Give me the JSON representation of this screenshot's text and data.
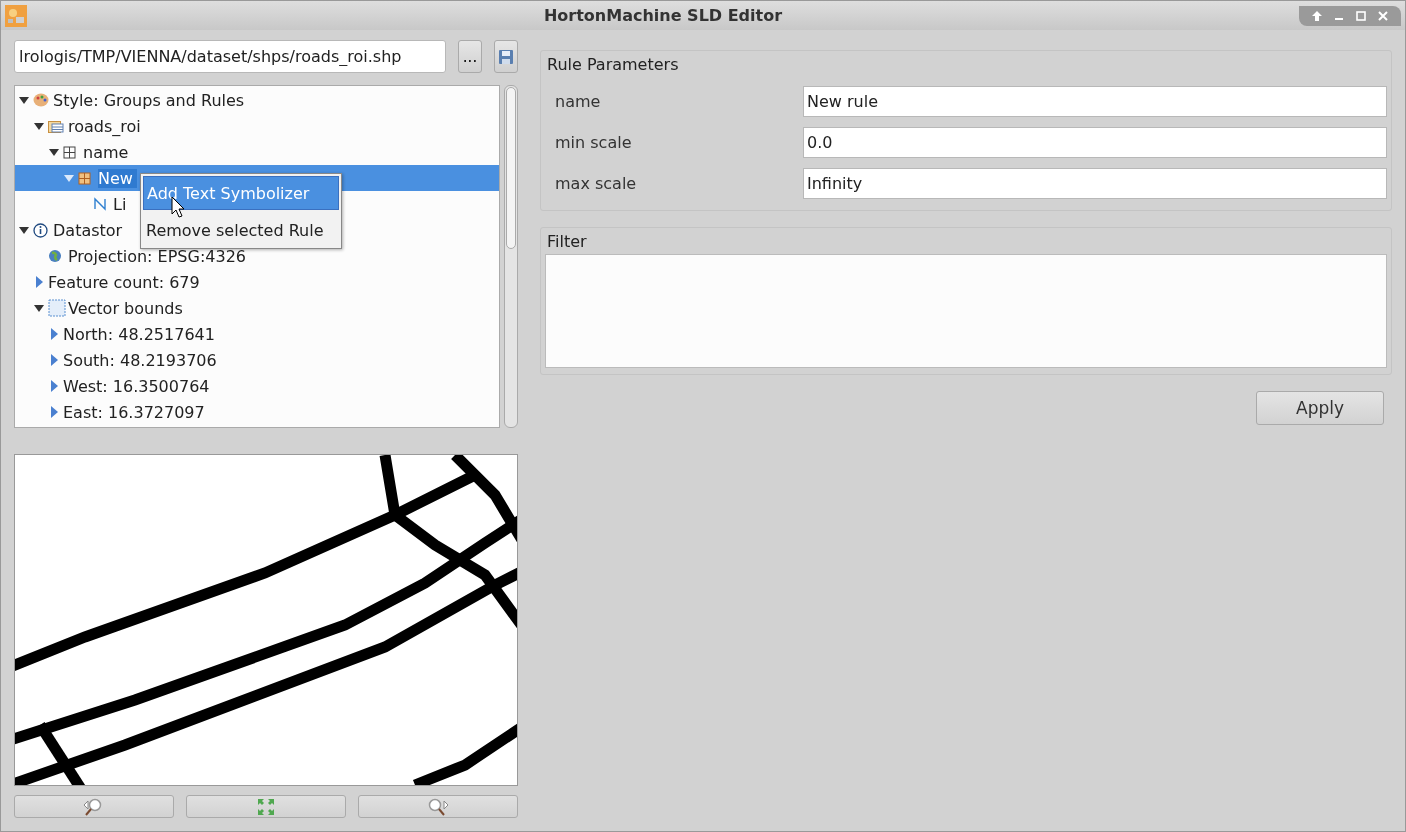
{
  "window": {
    "title": "HortonMachine SLD Editor"
  },
  "path_field": {
    "value": "lrologis/TMP/VIENNA/dataset/shps/roads_roi.shp"
  },
  "browse_button": {
    "label": "..."
  },
  "tree": [
    {
      "label": "Style: Groups and Rules",
      "kind": "palette",
      "expanded": true,
      "selected": false,
      "children": [
        {
          "label": "roads_roi",
          "kind": "table",
          "expanded": true,
          "selected": false,
          "children": [
            {
              "label": "name",
              "kind": "grid",
              "expanded": true,
              "selected": false,
              "children": [
                {
                  "label": "New",
                  "kind": "rule",
                  "expanded": true,
                  "selected": true,
                  "children": [
                    {
                      "label": "Li",
                      "kind": "line",
                      "selected": false
                    }
                  ]
                }
              ]
            }
          ]
        }
      ]
    },
    {
      "label": "Datastor",
      "kind": "info",
      "expanded": true,
      "selected": false,
      "children": [
        {
          "label": "Projection: EPSG:4326",
          "kind": "globe",
          "selected": false
        },
        {
          "label": "Feature count: 679",
          "kind": "none",
          "expanded": false,
          "selected": false
        },
        {
          "label": "Vector bounds",
          "kind": "bounds",
          "expanded": true,
          "selected": false,
          "children": [
            {
              "label": "North: 48.2517641",
              "kind": "none",
              "expanded": false,
              "selected": false
            },
            {
              "label": "South: 48.2193706",
              "kind": "none",
              "expanded": false,
              "selected": false
            },
            {
              "label": "West: 16.3500764",
              "kind": "none",
              "expanded": false,
              "selected": false
            },
            {
              "label": "East: 16.3727097",
              "kind": "none",
              "expanded": false,
              "selected": false
            }
          ]
        }
      ]
    }
  ],
  "context_menu": [
    {
      "label": "Add Text Symbolizer",
      "selected": true
    },
    {
      "label": "Remove selected Rule",
      "selected": false
    }
  ],
  "rule_parameters": {
    "title": "Rule Parameters",
    "fields": [
      {
        "label": "name",
        "value": "New rule"
      },
      {
        "label": "min scale",
        "value": "0.0"
      },
      {
        "label": "max scale",
        "value": "Infinity"
      }
    ]
  },
  "filter": {
    "title": "Filter"
  },
  "apply_button": {
    "label": "Apply"
  }
}
